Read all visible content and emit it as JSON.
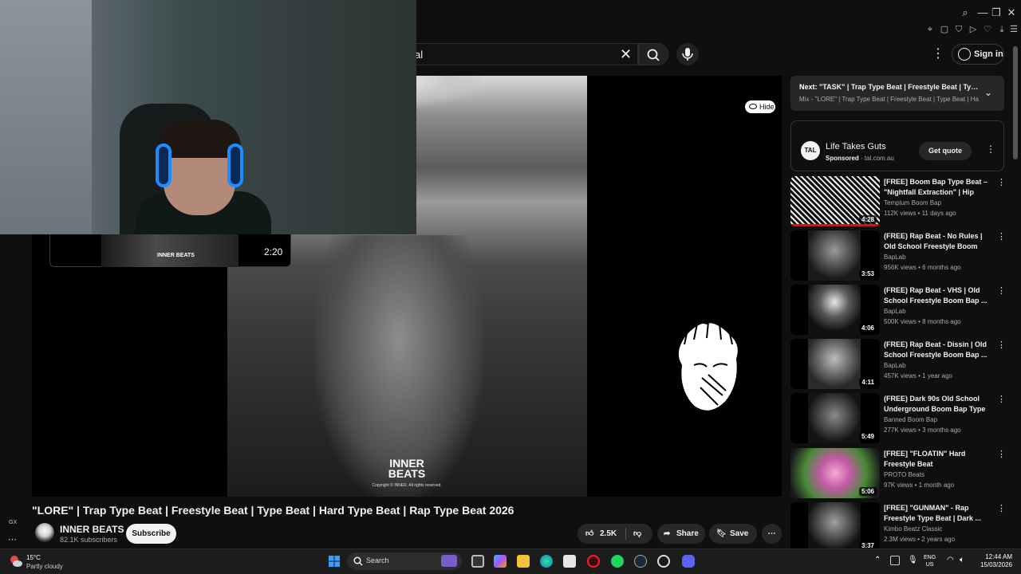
{
  "search": {
    "query": "al"
  },
  "header": {
    "sign_in": "Sign in"
  },
  "player": {
    "hide": "Hide",
    "watermark_line1": "INNER",
    "watermark_line2": "BEATS",
    "copyright": "Copyright © INNER. All rights reserved."
  },
  "mini_preview": {
    "logo": "INNER BEATS",
    "time": "2:20"
  },
  "video": {
    "title": "\"LORE\" | Trap Type Beat | Freestyle Beat | Type Beat | Hard Type Beat | Rap Type Beat 2026",
    "channel": "INNER BEATS",
    "subscribers": "82.1K subscribers",
    "subscribe": "Subscribe",
    "likes": "2.5K",
    "share": "Share",
    "save": "Save"
  },
  "sidebar_left": {
    "gx": "GX"
  },
  "next": {
    "label": "Next:",
    "title": "\"TASK\" | Trap Type Beat | Freestyle Beat | Typ...",
    "mix": "Mix - \"LORE\" | Trap Type Beat | Freestyle Beat | Type Beat | Hard"
  },
  "ad": {
    "logo": "TAL",
    "title": "Life Takes Guts",
    "sponsored": "Sponsored",
    "domain": "tal.com.au",
    "cta": "Get quote"
  },
  "recommendations": [
    {
      "title": "[FREE] Boom Bap Type Beat – \"Nightfall Extraction\" | Hip Hop...",
      "channel": "Templum Boom Bap",
      "meta": "112K views • 11 days ago",
      "duration": "4:28",
      "watched": 1.0
    },
    {
      "title": "(FREE) Rap Beat - No Rules | Old School Freestyle Boom Bap ...",
      "channel": "BapLab",
      "meta": "956K views • 6 months ago",
      "duration": "3:53"
    },
    {
      "title": "(FREE) Rap Beat - VHS | Old School Freestyle Boom Bap ...",
      "channel": "BapLab",
      "meta": "500K views • 8 months ago",
      "duration": "4:06"
    },
    {
      "title": "(FREE) Rap Beat - Dissin | Old School Freestyle Boom Bap ...",
      "channel": "BapLab",
      "meta": "457K views • 1 year ago",
      "duration": "4:11"
    },
    {
      "title": "(FREE) Dark 90s Old School Underground Boom Bap Type ...",
      "channel": "Banned Boom Bap",
      "meta": "277K views • 3 months ago",
      "duration": "5:49"
    },
    {
      "title": "[FREE] \"FLOATIN\" Hard Freestyle Beat",
      "channel": "PROTO Beats",
      "meta": "97K views • 1 month ago",
      "duration": "5:06"
    },
    {
      "title": "[FREE] \"GUNMAN\" - Rap Freestyle Type Beat | Dark ...",
      "channel": "Kimbo Beatz Classic",
      "meta": "2.3M views • 2 years ago",
      "duration": "3:37"
    }
  ],
  "taskbar": {
    "temp": "15°C",
    "weather": "Partly cloudy",
    "search": "Search",
    "lang1": "ENG",
    "lang2": "US",
    "time": "12:44 AM",
    "date": "15/03/2026"
  },
  "colors": {
    "accent": "#ff0000",
    "bg": "#0f0f0f",
    "pill": "#272727"
  }
}
